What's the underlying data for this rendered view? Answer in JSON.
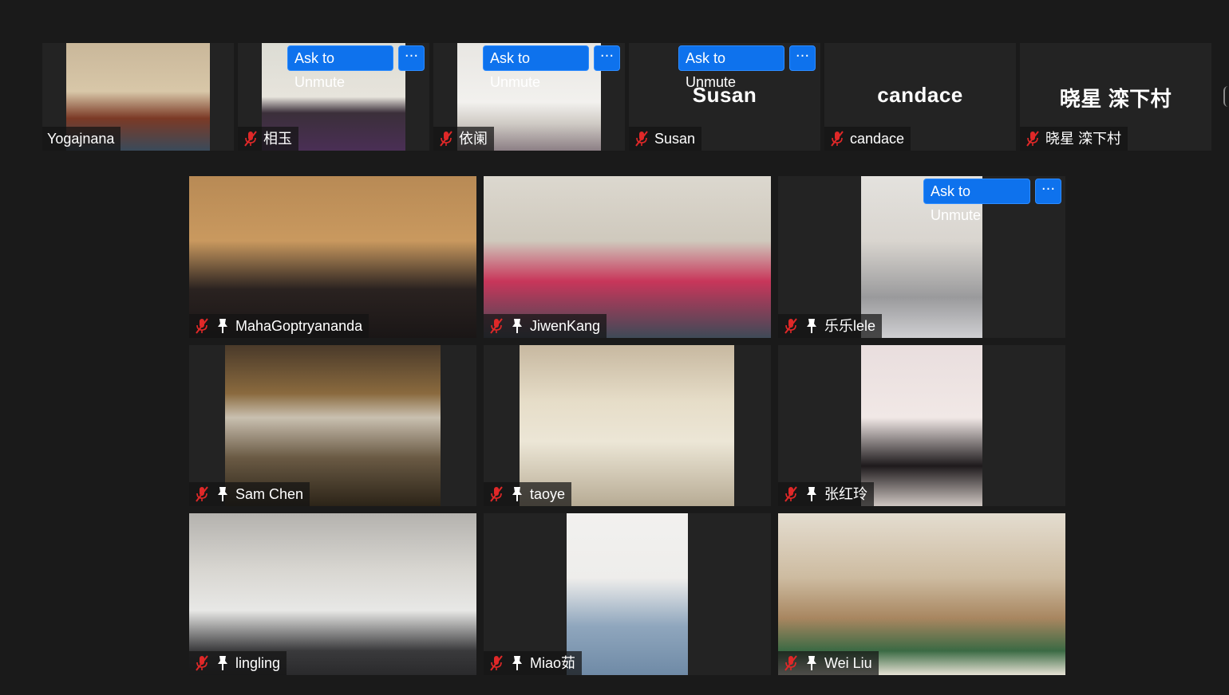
{
  "controls": {
    "ask_to_unmute": "Ask to Unmute",
    "more": "···"
  },
  "top_row": [
    {
      "name": "Yogajnana",
      "video": true
    },
    {
      "name": "相玉",
      "video": true,
      "unmute_button": true
    },
    {
      "name": "依阑",
      "video": true,
      "unmute_button": true
    },
    {
      "name": "Susan",
      "display_name": "Susan",
      "video": false,
      "unmute_button": true
    },
    {
      "name": "candace",
      "display_name": "candace",
      "video": false
    },
    {
      "name": "晓星 滦下村",
      "display_name": "晓星 滦下村",
      "video": false
    }
  ],
  "grid": [
    {
      "name": "MahaGoptryananda"
    },
    {
      "name": "JiwenKang"
    },
    {
      "name": "乐乐lele",
      "unmute_button": true
    },
    {
      "name": "Sam Chen"
    },
    {
      "name": "taoye"
    },
    {
      "name": "张红玲"
    },
    {
      "name": "lingling"
    },
    {
      "name": "Miao茹"
    },
    {
      "name": "Wei Liu"
    }
  ],
  "colors": {
    "background": "#1a1a1a",
    "tile": "#232323",
    "button_blue": "#0e72ed",
    "muted_red": "#e02828"
  },
  "icons": {
    "muted": "microphone-muted-icon",
    "pinned": "pin-icon",
    "more": "more-options-icon"
  }
}
